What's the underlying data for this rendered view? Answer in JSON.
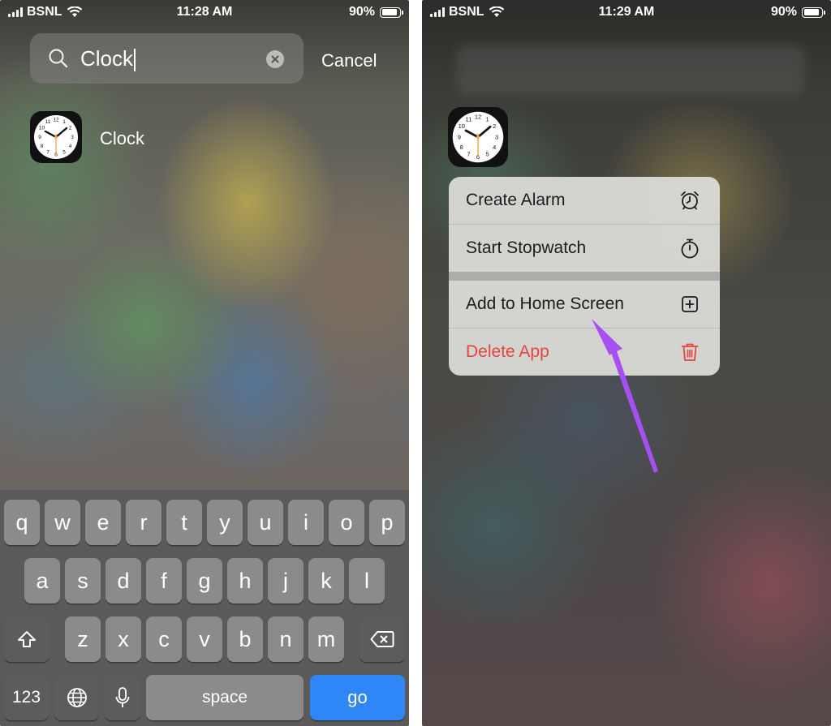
{
  "left": {
    "status": {
      "carrier": "BSNL",
      "time": "11:28 AM",
      "battery": "90%",
      "battery_level": 0.9
    },
    "search": {
      "query": "Clock",
      "cancel_label": "Cancel"
    },
    "result": {
      "app_name": "Clock",
      "icon": "clock-app-icon"
    },
    "keyboard": {
      "row1": [
        "q",
        "w",
        "e",
        "r",
        "t",
        "y",
        "u",
        "i",
        "o",
        "p"
      ],
      "row2": [
        "a",
        "s",
        "d",
        "f",
        "g",
        "h",
        "j",
        "k",
        "l"
      ],
      "row3": [
        "z",
        "x",
        "c",
        "v",
        "b",
        "n",
        "m"
      ],
      "numbers_label": "123",
      "space_label": "space",
      "go_label": "go",
      "icons": [
        "shift-icon",
        "backspace-icon",
        "globe-icon",
        "microphone-icon"
      ]
    }
  },
  "right": {
    "status": {
      "carrier": "BSNL",
      "time": "11:29 AM",
      "battery": "90%",
      "battery_level": 0.9
    },
    "context_menu": {
      "items": [
        {
          "label": "Create Alarm",
          "icon": "alarm-clock-icon"
        },
        {
          "label": "Start Stopwatch",
          "icon": "stopwatch-icon"
        },
        {
          "label": "Add to Home Screen",
          "icon": "plus-square-icon"
        },
        {
          "label": "Delete App",
          "icon": "trash-icon",
          "destructive": true
        }
      ]
    },
    "annotation": {
      "arrow_color": "#a64ff2"
    }
  },
  "colors": {
    "accent_blue": "#2f86f6",
    "destructive_red": "#e5453a",
    "arrow_purple": "#a64ff2"
  }
}
